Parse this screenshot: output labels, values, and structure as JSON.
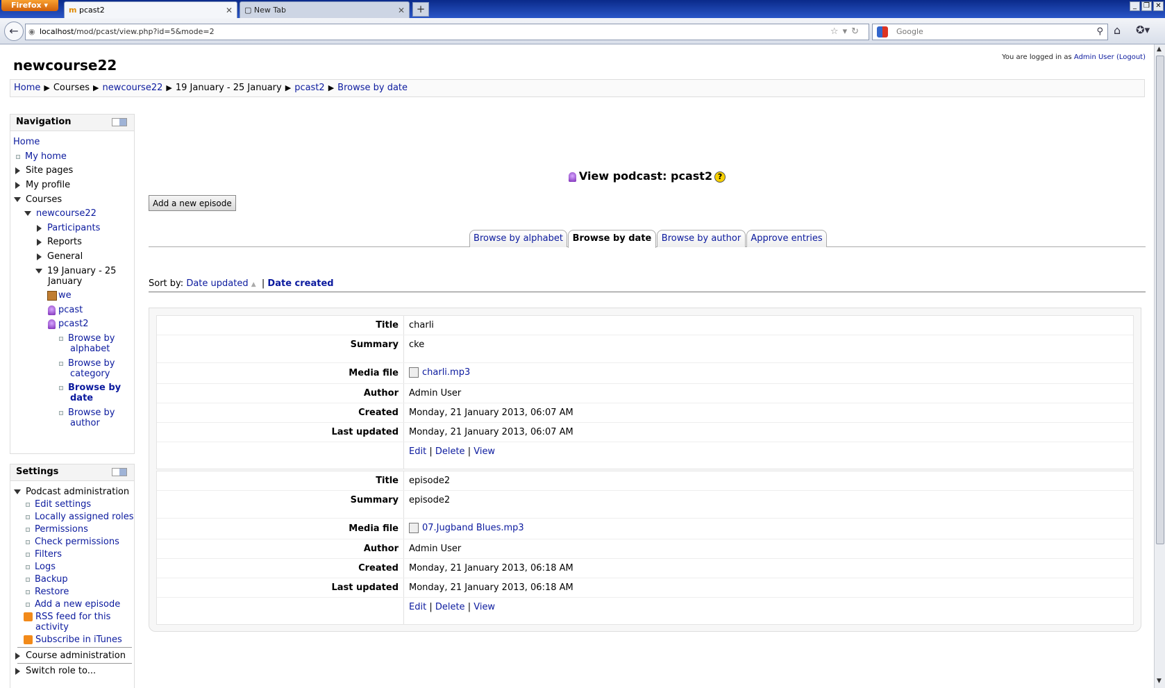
{
  "browser": {
    "app_button": "Firefox",
    "tabs": [
      {
        "title": "pcast2"
      },
      {
        "title": "New Tab"
      }
    ],
    "url_host": "localhost",
    "url_path": "/mod/pcast/view.php?id=5&mode=2",
    "search_placeholder": "Google"
  },
  "header": {
    "site_name": "newcourse22",
    "login_prefix": "You are logged in as ",
    "user_name": "Admin User",
    "logout": "(Logout)"
  },
  "breadcrumb": [
    "Home",
    "Courses",
    "newcourse22",
    "19 January - 25 January",
    "pcast2",
    "Browse by date"
  ],
  "navigation": {
    "title": "Navigation",
    "home": "Home",
    "my_home": "My home",
    "site_pages": "Site pages",
    "my_profile": "My profile",
    "courses": "Courses",
    "course": "newcourse22",
    "participants": "Participants",
    "reports": "Reports",
    "general": "General",
    "week_line1": "19 January - 25",
    "week_line2": "January",
    "we": "we",
    "pcast": "pcast",
    "pcast2": "pcast2",
    "browse_alpha_1": "Browse by",
    "browse_alpha_2": "alphabet",
    "browse_cat_1": "Browse by",
    "browse_cat_2": "category",
    "browse_date_1": "Browse by",
    "browse_date_2": "date",
    "browse_author_1": "Browse by",
    "browse_author_2": "author"
  },
  "settings": {
    "title": "Settings",
    "podcast_admin": "Podcast administration",
    "edit_settings": "Edit settings",
    "local_roles": "Locally assigned roles",
    "permissions": "Permissions",
    "check_permissions": "Check permissions",
    "filters": "Filters",
    "logs": "Logs",
    "backup": "Backup",
    "restore": "Restore",
    "add_episode": "Add a new episode",
    "rss_1": "RSS feed for this",
    "rss_2": "activity",
    "itunes": "Subscribe in iTunes",
    "course_admin": "Course administration",
    "switch_role": "Switch role to..."
  },
  "main": {
    "page_title": "View podcast: pcast2",
    "add_button": "Add a new episode",
    "tabs": [
      "Browse by alphabet",
      "Browse by date",
      "Browse by author",
      "Approve entries"
    ],
    "active_tab": "Browse by date",
    "sort_label": "Sort by:",
    "sort_updated": "Date updated",
    "sort_created": "Date created",
    "labels": {
      "title": "Title",
      "summary": "Summary",
      "media": "Media file",
      "author": "Author",
      "created": "Created",
      "updated": "Last updated"
    },
    "actions": {
      "edit": "Edit",
      "delete": "Delete",
      "view": "View"
    },
    "entries": [
      {
        "title": "charli",
        "summary": "cke",
        "media": "charli.mp3",
        "author": "Admin User",
        "created": "Monday, 21 January 2013, 06:07 AM",
        "updated": "Monday, 21 January 2013, 06:07 AM"
      },
      {
        "title": "episode2",
        "summary": "episode2",
        "media": "07.Jugband Blues.mp3",
        "author": "Admin User",
        "created": "Monday, 21 January 2013, 06:18 AM",
        "updated": "Monday, 21 January 2013, 06:18 AM"
      }
    ]
  }
}
